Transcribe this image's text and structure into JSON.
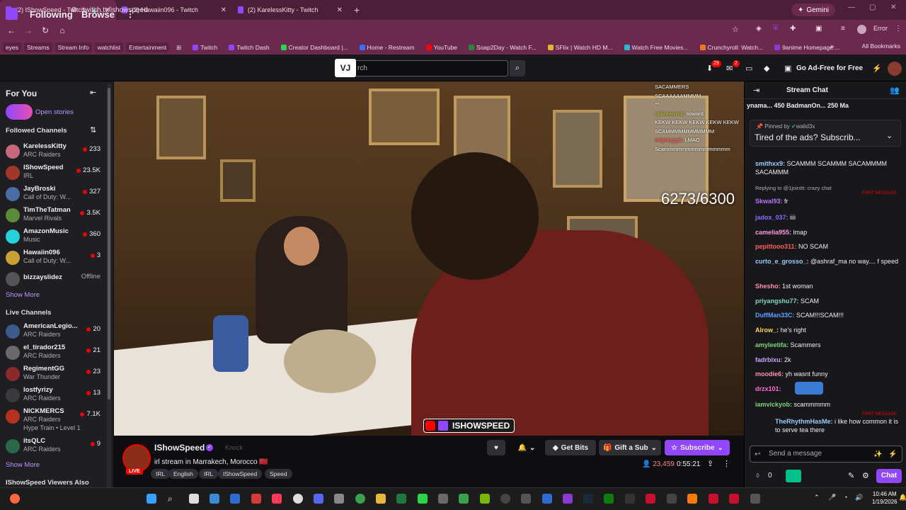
{
  "browser": {
    "tabs": [
      {
        "label": "(2) IShowSpeed - Twitch",
        "active": true
      },
      {
        "label": "(2) Hawaiin096 - Twitch",
        "active": false
      },
      {
        "label": "(2) KarelessKitty - Twitch",
        "active": false
      }
    ],
    "new_tab": "+",
    "gemini": "Gemini",
    "url": "twitch.tv/ishowspeed",
    "error_label": "Error",
    "bookmark_chips": [
      "eyes",
      "Streams",
      "Stream Info",
      "watchlist",
      "Entertainment"
    ],
    "bookmarks": [
      "Twitch",
      "Twitch Dash",
      "Creator Dashboard |...",
      "Home - Restream",
      "YouTube",
      "Soap2Day - Watch F...",
      "SFlix | Watch HD M...",
      "Watch Free Movies...",
      "Crunchyroll: Watch...",
      "9anime Homepage:..."
    ],
    "all_bookmarks": "All Bookmarks",
    "ext_badge": "29"
  },
  "topnav": {
    "following": "Following",
    "browse": "Browse",
    "search_placeholder": "Search",
    "search_partial": "rch",
    "notif_count_1": "29",
    "notif_count_2": "2",
    "ad_free": "Go Ad-Free for Free"
  },
  "sidebar": {
    "for_you": "For You",
    "open_stories": "Open stories",
    "followed_title": "Followed Channels",
    "followed": [
      {
        "name": "KarelessKitty",
        "game": "ARC Raiders",
        "viewers": "233",
        "color": "#c7697c"
      },
      {
        "name": "IShowSpeed",
        "game": "IRL",
        "viewers": "23.5K",
        "color": "#a3362a"
      },
      {
        "name": "JayBroski",
        "game": "Call of Duty: W...",
        "viewers": "327",
        "color": "#4a6ea3"
      },
      {
        "name": "TimTheTatman",
        "game": "Marvel Rivals",
        "viewers": "3.5K",
        "color": "#5a8a3a"
      },
      {
        "name": "AmazonMusic",
        "game": "Music",
        "viewers": "360",
        "color": "#25d1da"
      },
      {
        "name": "Hawaiin096",
        "game": "Call of Duty: W...",
        "viewers": "3",
        "color": "#c9a033"
      },
      {
        "name": "bizzayslidez",
        "game": "",
        "viewers": "Offline",
        "color": "#555555"
      }
    ],
    "show_more_1": "Show More",
    "live_title": "Live Channels",
    "live": [
      {
        "name": "AmericanLegio...",
        "game": "ARC Raiders",
        "viewers": "20",
        "color": "#3b5b8a"
      },
      {
        "name": "el_tirador215",
        "game": "ARC Raiders",
        "viewers": "21",
        "color": "#6a6a6a"
      },
      {
        "name": "RegimentGG",
        "game": "War Thunder",
        "viewers": "23",
        "color": "#8a2a2a"
      },
      {
        "name": "lostfyrizy",
        "game": "ARC Raiders",
        "viewers": "13",
        "color": "#3a3a3a"
      },
      {
        "name": "NICKMERCS",
        "game": "ARC Raiders",
        "extra": "Hype Train • Level 1",
        "viewers": "7.1K",
        "color": "#b5321f"
      },
      {
        "name": "itsQLC",
        "game": "ARC Raiders",
        "viewers": "9",
        "color": "#2a6a4a"
      }
    ],
    "show_more_2": "Show More",
    "viewers_also": "IShowSpeed Viewers Also"
  },
  "video": {
    "counter": "6273/6300",
    "watermark": "ISHOWSPEED",
    "overlay_chat": [
      {
        "user": "",
        "text": "SACAMMERS"
      },
      {
        "user": "",
        "text": "SCAAAAAAMMMM"
      },
      {
        "user": "",
        "text": "^^"
      },
      {
        "user": "splinterrrr1:",
        "text": "soward"
      },
      {
        "user": "",
        "text": "KEKW KEKW KEKW KEKW KEKW"
      },
      {
        "user": "",
        "text": "SCAMMMMMMMMMMM"
      },
      {
        "user": "mightygg6:",
        "text": "LMAO"
      },
      {
        "user": "",
        "text": "Scammmmmmmmmmmmmmm"
      }
    ]
  },
  "stream_info": {
    "channel": "IShowSpeed",
    "knock": "Knock",
    "live_badge": "LIVE",
    "title": "irl stream in Marrakech, Morocco 🇲🇦",
    "tags": [
      "IRL",
      "English",
      "IRL",
      "IShowSpeed",
      "Speed"
    ],
    "get_bits": "Get Bits",
    "gift_sub": "Gift a Sub",
    "subscribe": "Subscribe",
    "viewers": "23,459",
    "uptime": "0:55:21"
  },
  "chat": {
    "title": "Stream Chat",
    "gift_row": "ynama...  450   BadmanOn...  250   Ma",
    "pinned_by": "Pinned by",
    "pinned_user": "walid3x",
    "pinned_msg": "Tired of the ads? Subscrib...",
    "reply_note": "Replying to @1jointtt: crazy chat",
    "first_message": "FIRST MESSAGE",
    "messages": [
      {
        "user": "smithxx9:",
        "text": "SCAMMM SCAMMM SACAMMMM SACAMMM",
        "color": "#9acdff"
      },
      {
        "user": "Skwal93:",
        "text": "fr",
        "color": "#b675ff"
      },
      {
        "user": "jadox_037:",
        "text": "iiii",
        "color": "#8a6bff"
      },
      {
        "user": "camelia955:",
        "text": "lmap",
        "color": "#ff9ae0"
      },
      {
        "user": "pepittooo311:",
        "text": "NO SCAM",
        "color": "#ff5a5a"
      },
      {
        "user": "curto_e_grosso_:",
        "text": "@ashraf_ma no way.... f speed",
        "color": "#9acdff"
      },
      {
        "user": "Shesho:",
        "text": "1st woman",
        "color": "#ff8fb0"
      },
      {
        "user": "priyangshu77:",
        "text": "SCAM",
        "color": "#7fd7c4"
      },
      {
        "user": "DuffMan33C:",
        "text": "SCAM!!!SCAM!!!",
        "color": "#5aa0ff"
      },
      {
        "user": "Alrow_:",
        "text": "he's right",
        "color": "#ffd35a"
      },
      {
        "user": "amyleetifa:",
        "text": "Scammers",
        "color": "#7ad67a"
      },
      {
        "user": "fadrbixu:",
        "text": "2k",
        "color": "#c9a0ff"
      },
      {
        "user": "moodie6:",
        "text": "yh wasnt funny",
        "color": "#ff8fb0"
      },
      {
        "user": "drzx101:",
        "text": "",
        "color": "#ff6bd6"
      },
      {
        "user": "iamvickyob:",
        "text": "scammmmm",
        "color": "#7ad67a"
      },
      {
        "user": "TheRhythmHasMe:",
        "text": "i like how common it is to serve tea there",
        "color": "#9acdff"
      }
    ],
    "input_placeholder": "Send a message",
    "points": "0",
    "chat_button": "Chat"
  },
  "taskbar": {
    "time": "10:46 AM",
    "date": "1/19/2026"
  }
}
